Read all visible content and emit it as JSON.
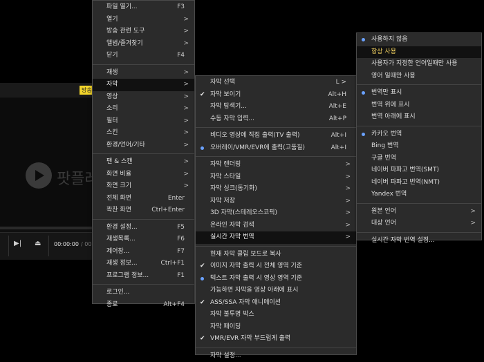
{
  "player": {
    "badge": "방송",
    "logo_text": "팟플레",
    "time_current": "00:00:00",
    "time_sep": "/ 00:0"
  },
  "main_menu": [
    {
      "label": "파일 열기...",
      "shortcut": "F3"
    },
    {
      "label": "열기",
      "arrow": ">"
    },
    {
      "label": "방송 관련 도구",
      "arrow": ">"
    },
    {
      "label": "앨범/즐겨찾기",
      "arrow": ">"
    },
    {
      "label": "닫기",
      "shortcut": "F4"
    },
    {
      "sep": true
    },
    {
      "label": "재생",
      "arrow": ">"
    },
    {
      "label": "자막",
      "arrow": ">",
      "active": true
    },
    {
      "label": "영상",
      "arrow": ">"
    },
    {
      "label": "소리",
      "arrow": ">"
    },
    {
      "label": "필터",
      "arrow": ">"
    },
    {
      "label": "스킨",
      "arrow": ">"
    },
    {
      "label": "환경/언어/기타",
      "arrow": ">"
    },
    {
      "sep": true
    },
    {
      "label": "팬 & 스캔",
      "arrow": ">"
    },
    {
      "label": "화면 비율",
      "arrow": ">"
    },
    {
      "label": "화면 크기",
      "arrow": ">"
    },
    {
      "label": "전체 화면",
      "shortcut": "Enter"
    },
    {
      "label": "꽉찬 화면",
      "shortcut": "Ctrl+Enter"
    },
    {
      "sep": true
    },
    {
      "label": "환경 설정...",
      "shortcut": "F5"
    },
    {
      "label": "재생목록...",
      "shortcut": "F6"
    },
    {
      "label": "제어창...",
      "shortcut": "F7"
    },
    {
      "label": "재생 정보...",
      "shortcut": "Ctrl+F1"
    },
    {
      "label": "프로그램 정보...",
      "shortcut": "F1"
    },
    {
      "sep": true
    },
    {
      "label": "로그인..."
    },
    {
      "label": "종료",
      "shortcut": "Alt+F4"
    }
  ],
  "subtitle_menu": [
    {
      "label": "자막 선택",
      "shortcut": "L >"
    },
    {
      "label": "자막 보이기",
      "shortcut": "Alt+H",
      "check": true
    },
    {
      "label": "자막 탐색기...",
      "shortcut": "Alt+E"
    },
    {
      "label": "수동 자막 입력...",
      "shortcut": "Alt+P"
    },
    {
      "sep": true
    },
    {
      "label": "비디오 영상에 직접 출력(TV 출력)",
      "shortcut": "Alt+I"
    },
    {
      "label": "오버레이/VMR/EVR에 출력(고품질)",
      "shortcut": "Alt+I",
      "dot": true
    },
    {
      "sep": true
    },
    {
      "label": "자막 렌더링",
      "arrow": ">"
    },
    {
      "label": "자막 스타일",
      "arrow": ">"
    },
    {
      "label": "자막 싱크(동기화)",
      "arrow": ">"
    },
    {
      "label": "자막 저장",
      "arrow": ">"
    },
    {
      "label": "3D 자막(스테레오스코픽)",
      "arrow": ">"
    },
    {
      "label": "온라인 자막 검색",
      "arrow": ">"
    },
    {
      "label": "실시간 자막 번역",
      "arrow": ">",
      "active": true
    },
    {
      "sep": true
    },
    {
      "label": "현재 자막 클립 보드로 복사"
    },
    {
      "label": "이미지 자막 출력 시 전체 영역 기준",
      "check": true
    },
    {
      "label": "텍스트 자막 출력 시 영상 영역 기준",
      "dot": true
    },
    {
      "label": "가능하면 자막을 영상 아래에 표시"
    },
    {
      "label": "ASS/SSA 자막 애니메이션",
      "check": true
    },
    {
      "label": "자막 불투명 박스"
    },
    {
      "label": "자막 페이딩"
    },
    {
      "label": "VMR/EVR 자막 부드럽게 출력",
      "check": true
    },
    {
      "sep": true
    },
    {
      "label": "자막 설정..."
    }
  ],
  "translate_menu": [
    {
      "label": "사용하지 않음",
      "dot": true
    },
    {
      "label": "항상 사용",
      "active": true,
      "gold": true
    },
    {
      "label": "사용자가 지정한 언어일때만 사용"
    },
    {
      "label": "영어 일때만 사용"
    },
    {
      "sep": true
    },
    {
      "label": "번역만 표시",
      "dot": true
    },
    {
      "label": "번역 위에 표시"
    },
    {
      "label": "번역 아래에 표시"
    },
    {
      "sep": true
    },
    {
      "label": "카카오 번역",
      "dot": true
    },
    {
      "label": "Bing 번역"
    },
    {
      "label": "구글 번역"
    },
    {
      "label": "네이버 파파고 번역(SMT)"
    },
    {
      "label": "네이버 파파고 번역(NMT)"
    },
    {
      "label": "Yandex 번역"
    },
    {
      "sep": true
    },
    {
      "label": "원본 언어",
      "arrow": ">"
    },
    {
      "label": "대상 언어",
      "arrow": ">"
    },
    {
      "sep": true
    },
    {
      "label": "실시간 자막 번역 설정..."
    }
  ]
}
